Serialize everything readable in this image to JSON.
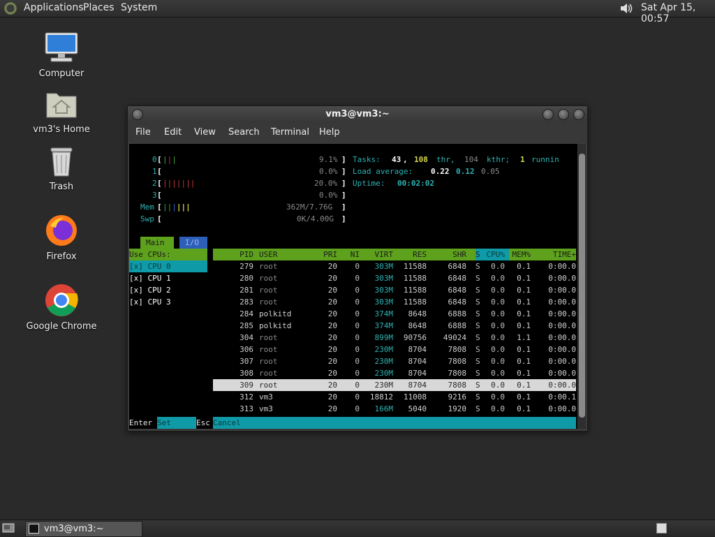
{
  "top_panel": {
    "menus": [
      "Applications",
      "Places",
      "System"
    ],
    "clock": "Sat Apr 15, 00:57"
  },
  "desktop": {
    "icons": [
      "Computer",
      "vm3's Home",
      "Trash",
      "Firefox",
      "Google Chrome"
    ]
  },
  "window": {
    "title": "vm3@vm3:~",
    "menu": [
      "File",
      "Edit",
      "View",
      "Search",
      "Terminal",
      "Help"
    ]
  },
  "htop": {
    "cpu0_label": "0",
    "cpu0_pct": "9.1%",
    "cpu1_label": "1",
    "cpu1_pct": "0.0%",
    "cpu2_label": "2",
    "cpu2_pct": "20.0%",
    "cpu3_label": "3",
    "cpu3_pct": "0.0%",
    "mem_label": "Mem",
    "mem_value": "362M/7.76G",
    "swp_label": "Swp",
    "swp_value": "0K/4.00G",
    "tasks_label": "Tasks:",
    "tasks_count": "43",
    "threads": "108",
    "thr_label": "thr,",
    "kthr": "104",
    "kthr_label": "kthr;",
    "running": "1",
    "running_label": "runnin",
    "load_label": "Load average:",
    "load1": "0.22",
    "load5": "0.12",
    "load15": "0.05",
    "uptime_label": "Uptime:",
    "uptime": "00:02:02",
    "tabs": [
      "Main",
      "I/O"
    ],
    "side_header": "Use CPUs:",
    "side_items": [
      "[x] CPU 0",
      "[x] CPU 1",
      "[x] CPU 2",
      "[x] CPU 3"
    ],
    "columns": [
      "PID",
      "USER",
      "PRI",
      "NI",
      "VIRT",
      "RES",
      "SHR",
      "S",
      "CPU%",
      "MEM%",
      "TIME+"
    ],
    "rows": [
      [
        "279",
        "root",
        "20",
        "0",
        "303M",
        "11588",
        "6848",
        "S",
        "0.0",
        "0.1",
        "0:00.0"
      ],
      [
        "280",
        "root",
        "20",
        "0",
        "303M",
        "11588",
        "6848",
        "S",
        "0.0",
        "0.1",
        "0:00.0"
      ],
      [
        "281",
        "root",
        "20",
        "0",
        "303M",
        "11588",
        "6848",
        "S",
        "0.0",
        "0.1",
        "0:00.0"
      ],
      [
        "283",
        "root",
        "20",
        "0",
        "303M",
        "11588",
        "6848",
        "S",
        "0.0",
        "0.1",
        "0:00.0"
      ],
      [
        "284",
        "polkitd",
        "20",
        "0",
        "374M",
        "8648",
        "6888",
        "S",
        "0.0",
        "0.1",
        "0:00.0"
      ],
      [
        "285",
        "polkitd",
        "20",
        "0",
        "374M",
        "8648",
        "6888",
        "S",
        "0.0",
        "0.1",
        "0:00.0"
      ],
      [
        "304",
        "root",
        "20",
        "0",
        "899M",
        "90756",
        "49024",
        "S",
        "0.0",
        "1.1",
        "0:00.0"
      ],
      [
        "306",
        "root",
        "20",
        "0",
        "230M",
        "8704",
        "7808",
        "S",
        "0.0",
        "0.1",
        "0:00.0"
      ],
      [
        "307",
        "root",
        "20",
        "0",
        "230M",
        "8704",
        "7808",
        "S",
        "0.0",
        "0.1",
        "0:00.0"
      ],
      [
        "308",
        "root",
        "20",
        "0",
        "230M",
        "8704",
        "7808",
        "S",
        "0.0",
        "0.1",
        "0:00.0"
      ],
      [
        "309",
        "root",
        "20",
        "0",
        "230M",
        "8704",
        "7808",
        "S",
        "0.0",
        "0.1",
        "0:00.0"
      ],
      [
        "312",
        "vm3",
        "20",
        "0",
        "18812",
        "11008",
        "9216",
        "S",
        "0.0",
        "0.1",
        "0:00.1"
      ],
      [
        "313",
        "vm3",
        "20",
        "0",
        "166M",
        "5040",
        "1920",
        "S",
        "0.0",
        "0.1",
        "0:00.0"
      ]
    ],
    "footer_key1": "Enter",
    "footer_act1": "Set",
    "footer_key2": "Esc",
    "footer_act2": "Cancel"
  },
  "taskbar": {
    "window_button": "vm3@vm3:~"
  },
  "colors": {
    "header_green": "#5ea11d",
    "teal": "#0e9aa7",
    "selected_row": "#d8d8d8",
    "tab_blue": "#2e5fb8"
  }
}
